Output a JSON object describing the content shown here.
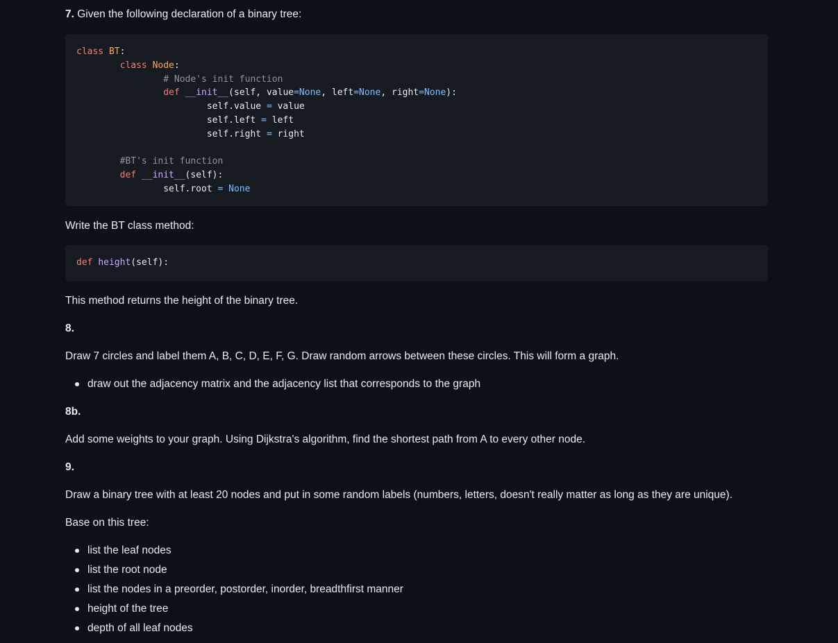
{
  "q7": {
    "number": "7.",
    "intro": "Given the following declaration of a binary tree:",
    "code": [
      [
        {
          "t": "class ",
          "c": "kw"
        },
        {
          "t": "BT",
          "c": "cls"
        },
        {
          "t": ":",
          "c": ""
        }
      ],
      [
        {
          "t": "        class ",
          "c": "kw"
        },
        {
          "t": "Node",
          "c": "cls"
        },
        {
          "t": ":",
          "c": ""
        }
      ],
      [
        {
          "t": "                # Node's init function",
          "c": "cm"
        }
      ],
      [
        {
          "t": "                def ",
          "c": "kw"
        },
        {
          "t": "__init__",
          "c": "fn"
        },
        {
          "t": "(self, value",
          "c": ""
        },
        {
          "t": "=",
          "c": "op"
        },
        {
          "t": "None",
          "c": "con"
        },
        {
          "t": ", left",
          "c": ""
        },
        {
          "t": "=",
          "c": "op"
        },
        {
          "t": "None",
          "c": "con"
        },
        {
          "t": ", right",
          "c": ""
        },
        {
          "t": "=",
          "c": "op"
        },
        {
          "t": "None",
          "c": "con"
        },
        {
          "t": "):",
          "c": ""
        }
      ],
      [
        {
          "t": "                        self.value ",
          "c": ""
        },
        {
          "t": "=",
          "c": "op"
        },
        {
          "t": " value",
          "c": ""
        }
      ],
      [
        {
          "t": "                        self.left ",
          "c": ""
        },
        {
          "t": "=",
          "c": "op"
        },
        {
          "t": " left",
          "c": ""
        }
      ],
      [
        {
          "t": "                        self.right ",
          "c": ""
        },
        {
          "t": "=",
          "c": "op"
        },
        {
          "t": " right",
          "c": ""
        }
      ],
      [
        {
          "t": "",
          "c": ""
        }
      ],
      [
        {
          "t": "        #BT's init function",
          "c": "cm"
        }
      ],
      [
        {
          "t": "        def ",
          "c": "kw"
        },
        {
          "t": "__init__",
          "c": "fn"
        },
        {
          "t": "(self):",
          "c": ""
        }
      ],
      [
        {
          "t": "                self.root ",
          "c": ""
        },
        {
          "t": "=",
          "c": "op"
        },
        {
          "t": " ",
          "c": ""
        },
        {
          "t": "None",
          "c": "con"
        }
      ]
    ],
    "write_method": "Write the BT class method:",
    "method_code": [
      [
        {
          "t": "def ",
          "c": "kw"
        },
        {
          "t": "height",
          "c": "fn"
        },
        {
          "t": "(self):",
          "c": ""
        }
      ]
    ],
    "returns": "This method returns the height of the binary tree."
  },
  "q8": {
    "number": "8.",
    "text": "Draw 7 circles and label them A, B, C, D, E, F, G. Draw random arrows between these circles. This will form a graph.",
    "bullets": [
      "draw out the adjacency matrix and the adjacency list that corresponds to the graph"
    ]
  },
  "q8b": {
    "number": "8b.",
    "text": "Add some weights to your graph. Using Dijkstra's algorithm, find the shortest path from A to every other node."
  },
  "q9": {
    "number": "9.",
    "text": "Draw a binary tree with at least 20 nodes and put in some random labels (numbers, letters, doesn't really matter as long as they are unique).",
    "base": "Base on this tree:",
    "bullets": [
      "list the leaf nodes",
      "list the root node",
      "list the nodes in a preorder, postorder, inorder, breadthfirst manner",
      "height of the tree",
      "depth of all leaf nodes"
    ]
  }
}
